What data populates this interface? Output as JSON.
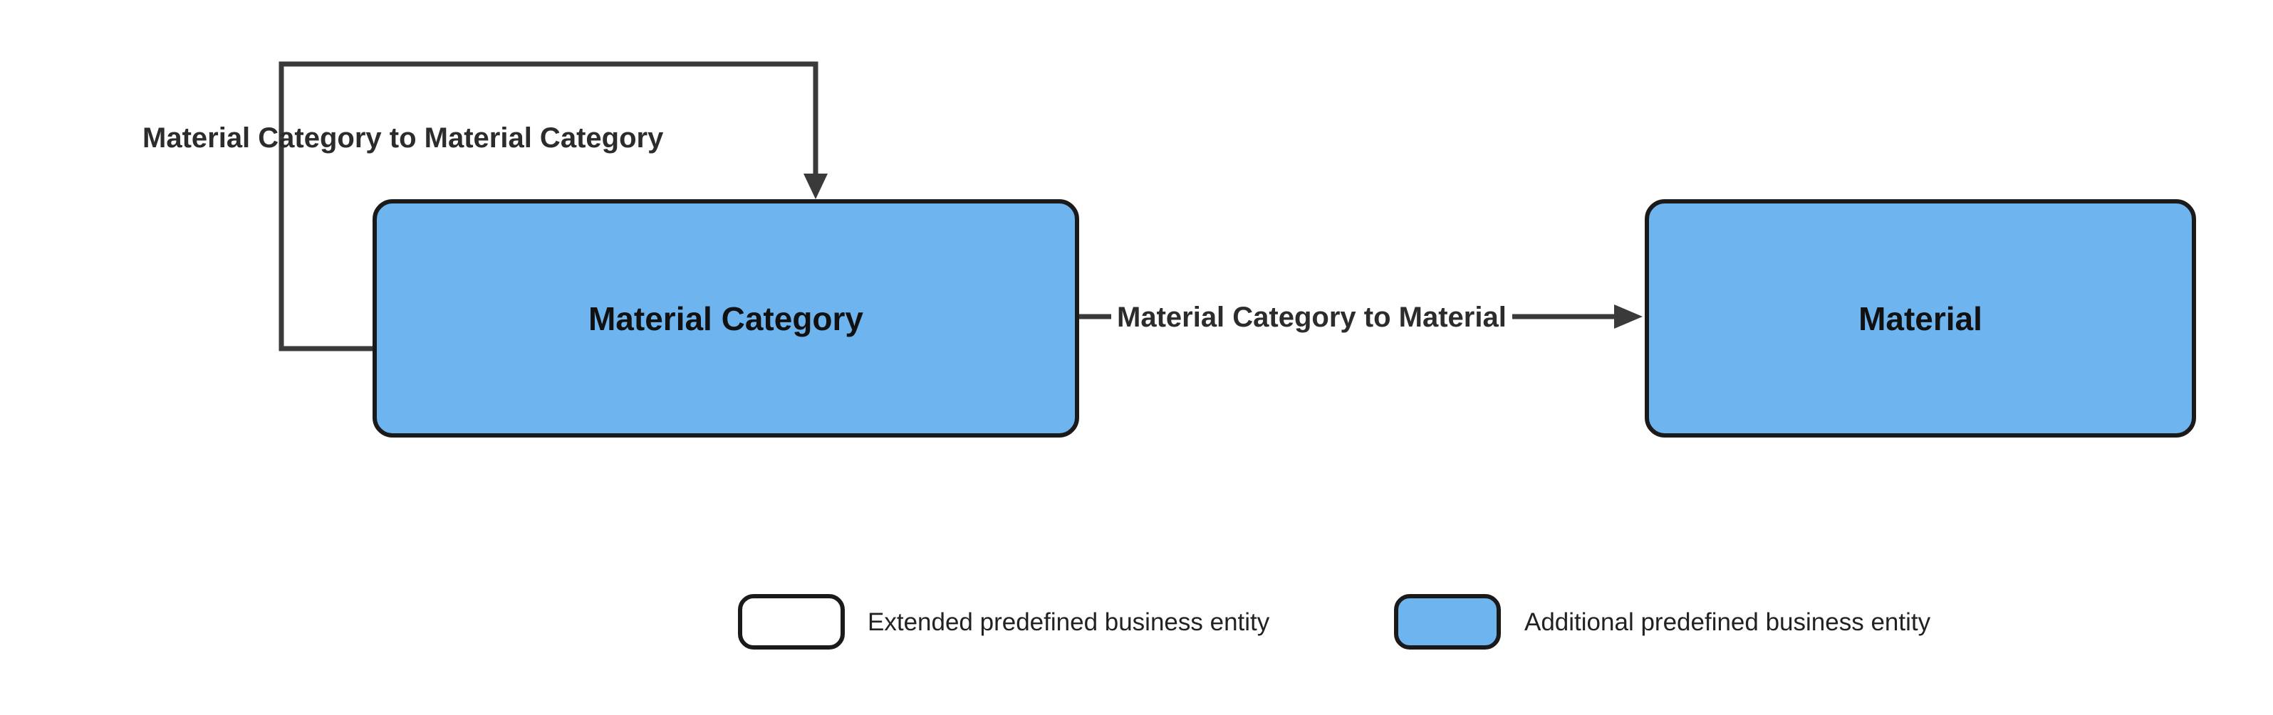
{
  "entities": {
    "material_category": {
      "label": "Material Category"
    },
    "material": {
      "label": "Material"
    }
  },
  "relationships": {
    "self": {
      "label": "Material Category to Material Category"
    },
    "to_material": {
      "label": "Material Category to Material"
    }
  },
  "legend": {
    "extended": {
      "label": "Extended predefined business entity"
    },
    "additional": {
      "label": "Additional predefined business entity"
    }
  }
}
